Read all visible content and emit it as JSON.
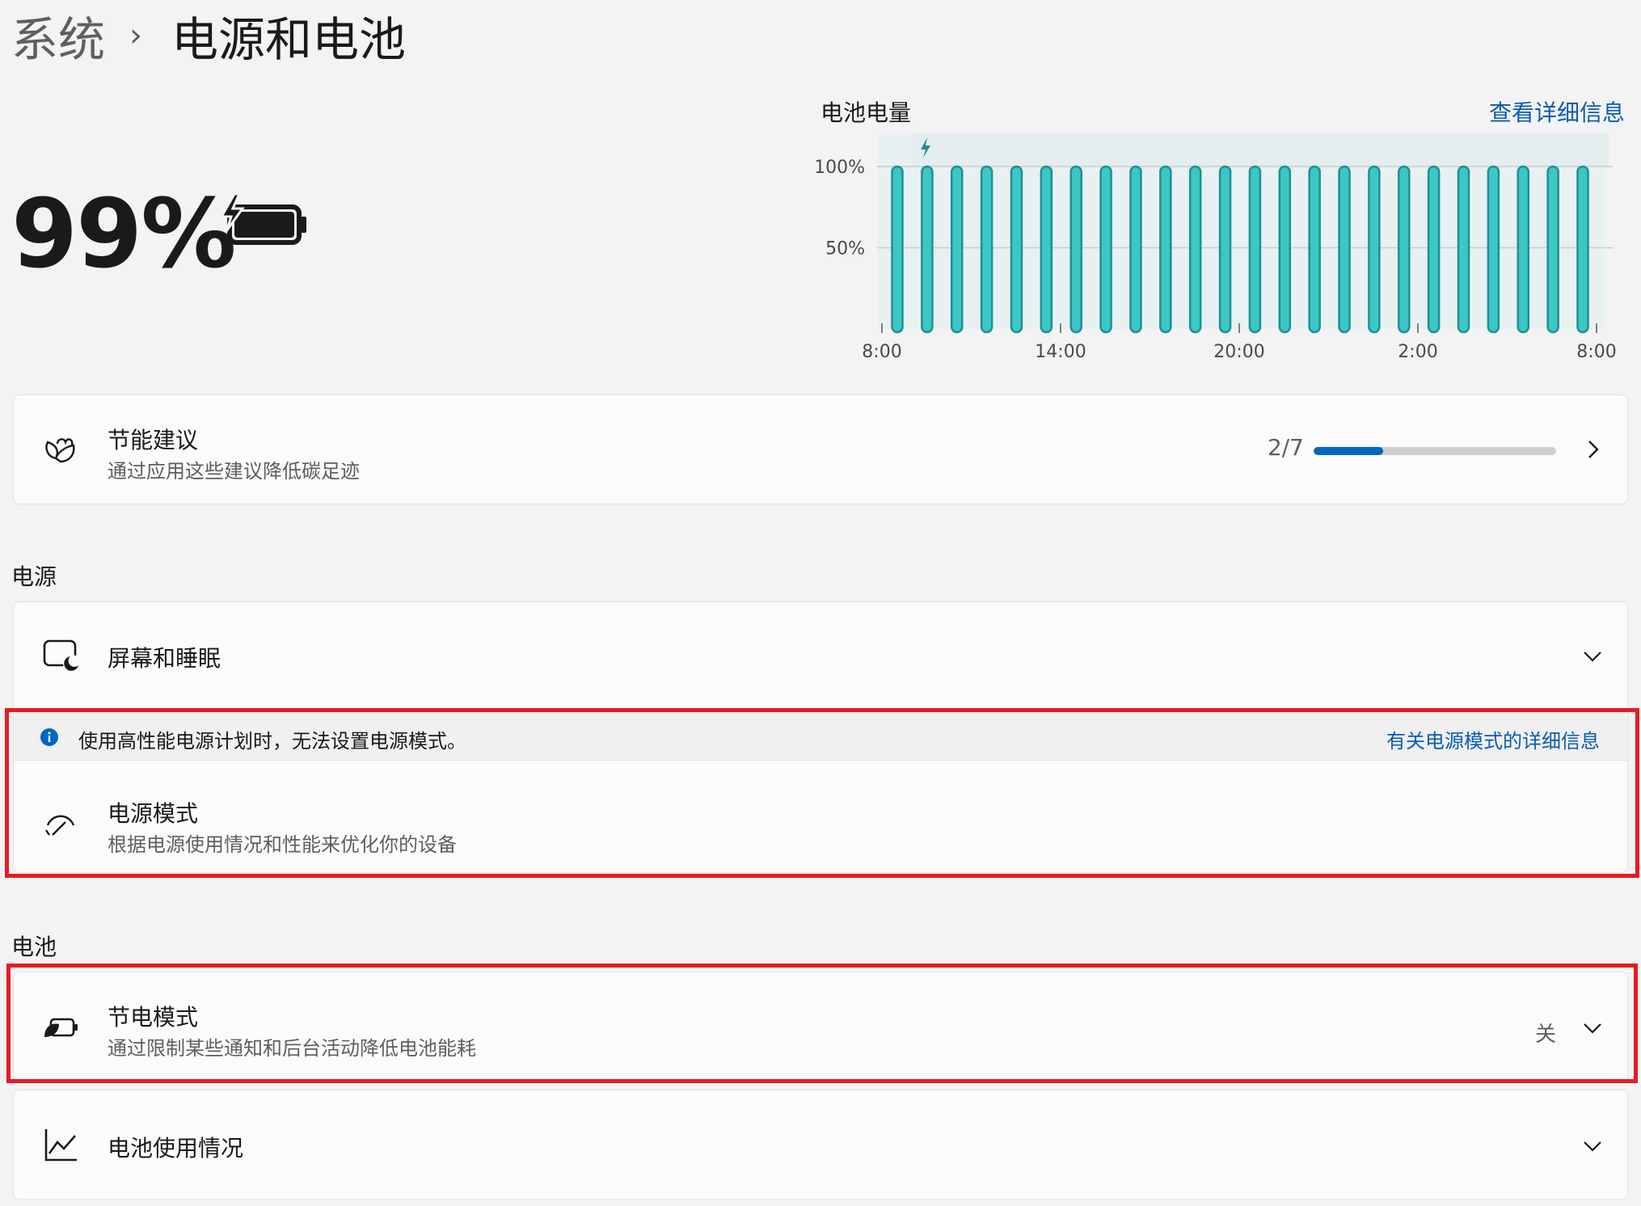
{
  "breadcrumb": {
    "parent": "系统",
    "separator": "›",
    "current": "电源和电池"
  },
  "battery": {
    "percent": "99%",
    "charging": true
  },
  "chart": {
    "title": "电池电量",
    "details_link": "查看详细信息"
  },
  "chart_data": {
    "type": "bar",
    "title": "电池电量",
    "y_tick_labels": [
      "100%",
      "50%"
    ],
    "x_tick_labels": [
      "8:00",
      "14:00",
      "20:00",
      "2:00",
      "8:00"
    ],
    "ylim": [
      0,
      100
    ],
    "values": [
      100,
      100,
      100,
      100,
      100,
      100,
      100,
      100,
      100,
      100,
      100,
      100,
      100,
      100,
      100,
      100,
      100,
      100,
      100,
      100,
      100,
      100,
      100,
      100
    ],
    "bar_color": "#3cc7c5",
    "bar_edge_color": "#1f8f97",
    "charging_marker": true,
    "grid": true
  },
  "energy": {
    "title": "节能建议",
    "subtitle": "通过应用这些建议降低碳足迹",
    "progress_text": "2/7",
    "progress_fraction": 0.2857
  },
  "power_section": {
    "label": "电源",
    "screen_sleep": {
      "title": "屏幕和睡眠"
    },
    "info_banner": {
      "text": "使用高性能电源计划时，无法设置电源模式。",
      "link": "有关电源模式的详细信息"
    },
    "power_mode": {
      "title": "电源模式",
      "subtitle": "根据电源使用情况和性能来优化你的设备"
    }
  },
  "battery_section": {
    "label": "电池",
    "saver": {
      "title": "节电模式",
      "subtitle": "通过限制某些通知和后台活动降低电池能耗",
      "status": "关"
    },
    "usage": {
      "title": "电池使用情况"
    }
  },
  "colors": {
    "accent": "#0067c0",
    "link": "#0a5bb0",
    "highlight": "#e51b24",
    "bar": "#3cc7c5"
  }
}
